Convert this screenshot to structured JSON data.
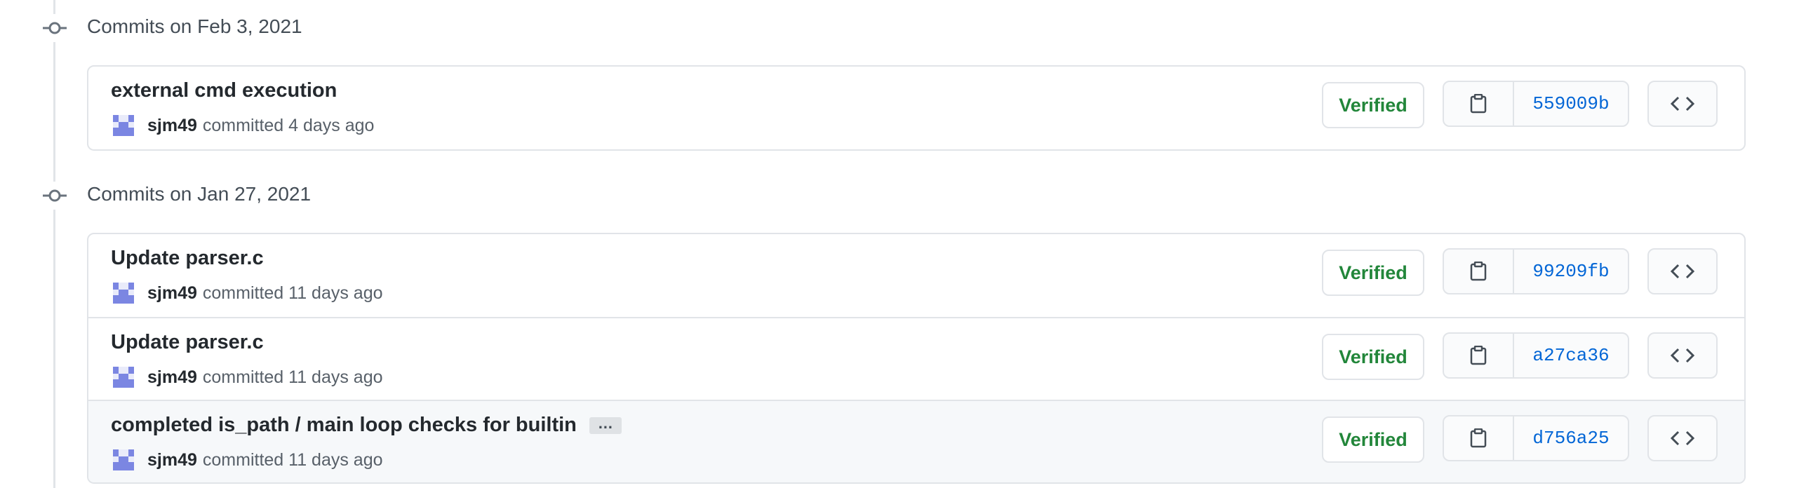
{
  "groups": [
    {
      "title": "Commits on Feb 3, 2021",
      "commits": [
        {
          "message": "external cmd execution",
          "author": "sjm49",
          "meta": "committed 4 days ago",
          "badge": "Verified",
          "sha": "559009b",
          "has_ellipsis": false
        }
      ]
    },
    {
      "title": "Commits on Jan 27, 2021",
      "commits": [
        {
          "message": "Update parser.c",
          "author": "sjm49",
          "meta": "committed 11 days ago",
          "badge": "Verified",
          "sha": "99209fb",
          "has_ellipsis": false
        },
        {
          "message": "Update parser.c",
          "author": "sjm49",
          "meta": "committed 11 days ago",
          "badge": "Verified",
          "sha": "a27ca36",
          "has_ellipsis": false
        },
        {
          "message": "completed is_path / main loop checks for builtin",
          "author": "sjm49",
          "meta": "committed 11 days ago",
          "badge": "Verified",
          "sha": "d756a25",
          "has_ellipsis": true,
          "ellipsis_label": "…"
        }
      ]
    }
  ],
  "icons": {
    "commit_node": "git-commit-icon",
    "copy": "clipboard-icon",
    "browse": "code-icon",
    "avatar": "identicon-avatar"
  },
  "colors": {
    "verified": "#22863a",
    "sha_link": "#0366d6",
    "avatar": "#7b86e2",
    "border": "#e1e4e8"
  }
}
